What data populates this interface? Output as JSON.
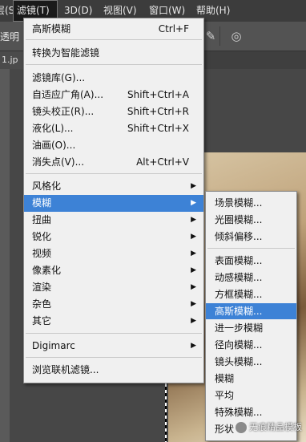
{
  "menubar": {
    "items": [
      {
        "label": "层(S)"
      },
      {
        "label": "滤镜(T)",
        "active": true
      },
      {
        "label": "3D(D)"
      },
      {
        "label": "视图(V)"
      },
      {
        "label": "窗口(W)"
      },
      {
        "label": "帮助(H)"
      }
    ]
  },
  "options_bar": {
    "partial_label": "透明",
    "tool_icons": [
      "pen-tool-icon",
      "target-icon"
    ]
  },
  "doc_tab": {
    "label": "1.jp"
  },
  "filter_menu": {
    "items": [
      {
        "label": "高斯模糊",
        "shortcut": "Ctrl+F"
      },
      {
        "label": "转换为智能滤镜"
      },
      {
        "label": "滤镜库(G)..."
      },
      {
        "label": "自适应广角(A)...",
        "shortcut": "Shift+Ctrl+A"
      },
      {
        "label": "镜头校正(R)...",
        "shortcut": "Shift+Ctrl+R"
      },
      {
        "label": "液化(L)...",
        "shortcut": "Shift+Ctrl+X"
      },
      {
        "label": "油画(O)..."
      },
      {
        "label": "消失点(V)...",
        "shortcut": "Alt+Ctrl+V"
      },
      {
        "label": "风格化"
      },
      {
        "label": "模糊",
        "highlighted": true
      },
      {
        "label": "扭曲"
      },
      {
        "label": "锐化"
      },
      {
        "label": "视频"
      },
      {
        "label": "像素化"
      },
      {
        "label": "渲染"
      },
      {
        "label": "杂色"
      },
      {
        "label": "其它"
      },
      {
        "label": "Digimarc"
      },
      {
        "label": "浏览联机滤镜..."
      }
    ]
  },
  "blur_submenu": {
    "items": [
      {
        "label": "场景模糊..."
      },
      {
        "label": "光圈模糊..."
      },
      {
        "label": "倾斜偏移..."
      },
      {
        "label": "表面模糊..."
      },
      {
        "label": "动感模糊..."
      },
      {
        "label": "方框模糊..."
      },
      {
        "label": "高斯模糊...",
        "highlighted": true
      },
      {
        "label": "进一步模糊"
      },
      {
        "label": "径向模糊..."
      },
      {
        "label": "镜头模糊..."
      },
      {
        "label": "模糊"
      },
      {
        "label": "平均"
      },
      {
        "label": "特殊模糊..."
      },
      {
        "label": "形状"
      }
    ]
  },
  "watermark": {
    "text": "无痕精品模板"
  },
  "colors": {
    "highlight": "#3d82d6",
    "menu_bg": "#f0f0f0",
    "menubar_bg": "#3c3c3c"
  }
}
